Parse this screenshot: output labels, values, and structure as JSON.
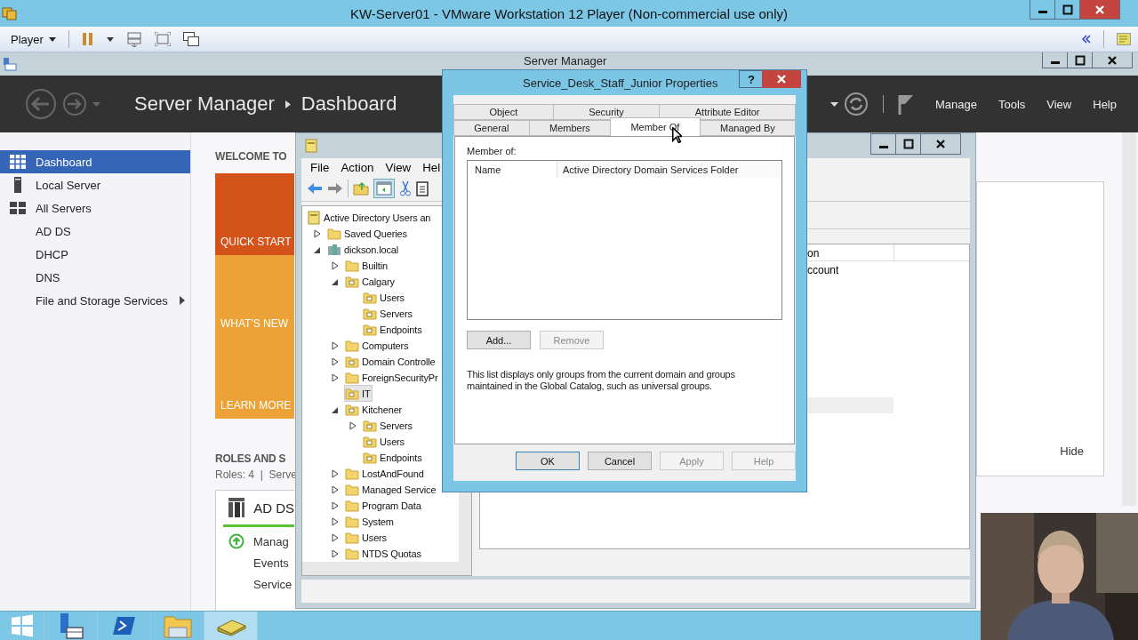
{
  "vm": {
    "title": "KW-Server01 - VMware Workstation 12 Player (Non-commercial use only)",
    "menu": "Player"
  },
  "server_manager": {
    "title": "Server Manager",
    "breadcrumb": [
      "Server Manager",
      "Dashboard"
    ],
    "menu": [
      "Manage",
      "Tools",
      "View",
      "Help"
    ],
    "nav": [
      {
        "label": "Dashboard",
        "selected": true
      },
      {
        "label": "Local Server",
        "selected": false
      },
      {
        "label": "All Servers",
        "selected": false
      },
      {
        "label": "AD DS",
        "selected": false
      },
      {
        "label": "DHCP",
        "selected": false
      },
      {
        "label": "DNS",
        "selected": false
      },
      {
        "label": "File and Storage Services",
        "selected": false,
        "submenu": true
      }
    ],
    "welcome": "WELCOME TO",
    "tiles": [
      {
        "label": "QUICK START",
        "color": "#d4531b"
      },
      {
        "label": "WHAT'S NEW",
        "color": "#eca237"
      },
      {
        "label": "LEARN MORE",
        "color": "#eca237"
      }
    ],
    "roles": {
      "heading": "ROLES AND S",
      "summary": "Roles: 4  |  Serve",
      "card_title": "AD DS",
      "card_rows": [
        "Manag",
        "Events",
        "Service"
      ]
    },
    "hide": "Hide"
  },
  "aduc": {
    "menu": [
      "File",
      "Action",
      "View",
      "Hel"
    ],
    "tree": [
      {
        "label": "Active Directory Users an",
        "kind": "snapin",
        "selected": false,
        "children": [
          {
            "label": "Saved Queries",
            "kind": "folder",
            "expanded": false,
            "selected": false
          },
          {
            "label": "dickson.local",
            "kind": "domain",
            "expanded": true,
            "selected": false,
            "children": [
              {
                "label": "Builtin",
                "kind": "folder",
                "expanded": false,
                "selected": false
              },
              {
                "label": "Calgary",
                "kind": "ou",
                "expanded": true,
                "selected": false,
                "children": [
                  {
                    "label": "Users",
                    "kind": "ou",
                    "selected": false
                  },
                  {
                    "label": "Servers",
                    "kind": "ou",
                    "selected": false
                  },
                  {
                    "label": "Endpoints",
                    "kind": "ou",
                    "selected": false
                  }
                ]
              },
              {
                "label": "Computers",
                "kind": "folder",
                "expanded": false,
                "selected": false
              },
              {
                "label": "Domain Controlle",
                "kind": "ou",
                "expanded": false,
                "selected": false
              },
              {
                "label": "ForeignSecurityPr",
                "kind": "folder",
                "expanded": false,
                "selected": false
              },
              {
                "label": "IT",
                "kind": "ou",
                "selected": true
              },
              {
                "label": "Kitchener",
                "kind": "ou",
                "expanded": true,
                "selected": false,
                "children": [
                  {
                    "label": "Servers",
                    "kind": "ou",
                    "expanded": false,
                    "selected": false
                  },
                  {
                    "label": "Users",
                    "kind": "ou",
                    "selected": false
                  },
                  {
                    "label": "Endpoints",
                    "kind": "ou",
                    "selected": false
                  }
                ]
              },
              {
                "label": "LostAndFound",
                "kind": "folder",
                "expanded": false,
                "selected": false
              },
              {
                "label": "Managed Service",
                "kind": "folder",
                "expanded": false,
                "selected": false
              },
              {
                "label": "Program Data",
                "kind": "folder",
                "expanded": false,
                "selected": false
              },
              {
                "label": "System",
                "kind": "folder",
                "expanded": false,
                "selected": false
              },
              {
                "label": "Users",
                "kind": "folder",
                "expanded": false,
                "selected": false
              },
              {
                "label": "NTDS Quotas",
                "kind": "folder",
                "expanded": false,
                "selected": false
              }
            ]
          }
        ]
      }
    ],
    "column_1": "on",
    "row_1": "ccount"
  },
  "dialog": {
    "title": "Service_Desk_Staff_Junior Properties",
    "help_glyph": "?",
    "tab_rows": [
      [
        {
          "label": "Object",
          "selected": false
        },
        {
          "label": "Security",
          "selected": false
        },
        {
          "label": "Attribute Editor",
          "selected": false
        }
      ],
      [
        {
          "label": "General",
          "selected": false
        },
        {
          "label": "Members",
          "selected": false
        },
        {
          "label": "Member Of",
          "selected": true
        },
        {
          "label": "Managed By",
          "selected": false
        }
      ]
    ],
    "list_label": "Member of:",
    "columns": [
      "Name",
      "Active Directory Domain Services Folder"
    ],
    "actions": [
      {
        "label": "Add...",
        "disabled": false
      },
      {
        "label": "Remove",
        "disabled": true
      }
    ],
    "note": "This list displays only groups from the current domain and groups maintained in the Global Catalog, such as universal groups.",
    "buttons": [
      {
        "label": "OK",
        "disabled": false
      },
      {
        "label": "Cancel",
        "disabled": false
      },
      {
        "label": "Apply",
        "disabled": true
      },
      {
        "label": "Help",
        "disabled": true
      }
    ]
  },
  "taskbar": [
    {
      "selected": false
    },
    {
      "selected": false
    },
    {
      "selected": false
    },
    {
      "selected": false
    },
    {
      "selected": true
    }
  ]
}
